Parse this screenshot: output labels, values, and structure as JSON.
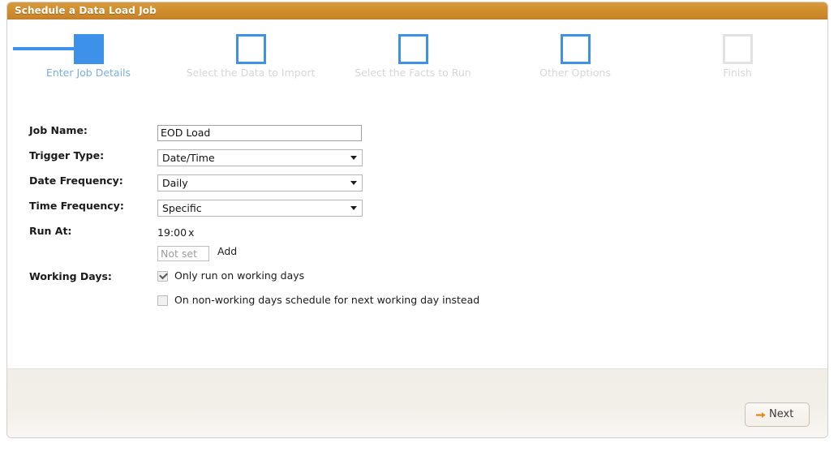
{
  "window": {
    "title": "Schedule a Data Load Job"
  },
  "steps": [
    {
      "label": "Enter Job Details",
      "state": "current"
    },
    {
      "label": "Select the Data to Import",
      "state": "upcoming"
    },
    {
      "label": "Select the Facts to Run",
      "state": "upcoming"
    },
    {
      "label": "Other Options",
      "state": "upcoming"
    },
    {
      "label": "Finish",
      "state": "disabled"
    }
  ],
  "form": {
    "job_name": {
      "label": "Job Name:",
      "value": "EOD Load",
      "placeholder": ""
    },
    "trigger_type": {
      "label": "Trigger Type:",
      "value": "Date/Time",
      "options": [
        "Date/Time"
      ]
    },
    "date_frequency": {
      "label": "Date Frequency:",
      "value": "Daily",
      "options": [
        "Daily"
      ]
    },
    "time_frequency": {
      "label": "Time Frequency:",
      "value": "Specific",
      "options": [
        "Specific"
      ]
    },
    "run_at": {
      "label": "Run At:",
      "times": [
        {
          "value": "19:00",
          "remove_label": "x"
        }
      ],
      "new_time_placeholder": "Not set",
      "new_time_value": "",
      "add_label": "Add"
    },
    "working_days": {
      "label": "Working Days:",
      "checkboxes": [
        {
          "label": "Only run on working days",
          "checked": true
        },
        {
          "label": "On non-working days schedule for next working day instead",
          "checked": false
        }
      ]
    }
  },
  "footer": {
    "next_label": "Next",
    "next_icon": "arrow-right-icon"
  },
  "colors": {
    "title_bar": "#d08f2d",
    "step_active": "#3d91e8",
    "step_label_active": "#7aaede",
    "step_label_inactive": "#d6d6d6",
    "arrow_accent": "#e8881c"
  }
}
